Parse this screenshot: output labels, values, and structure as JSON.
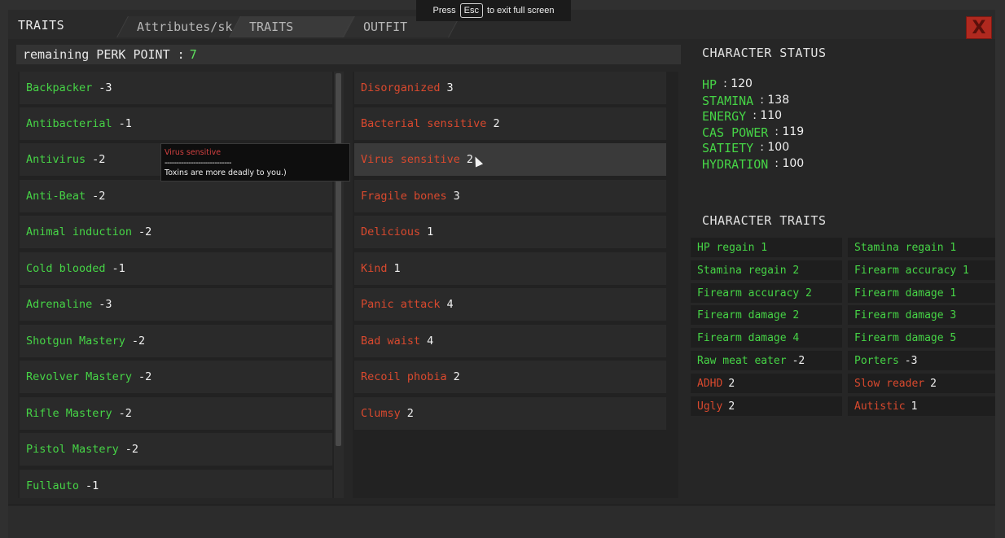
{
  "fullscreen_notice": {
    "before": "Press",
    "key": "Esc",
    "after": "to exit full screen"
  },
  "header": {
    "title": "TRAITS",
    "tabs": [
      "Attributes/sk",
      "TRAITS",
      "OUTFIT"
    ],
    "close_label": "X"
  },
  "perk": {
    "label": "remaining PERK POINT  :",
    "value": "7"
  },
  "positive_traits": [
    {
      "name": "Backpacker",
      "cost": "-3"
    },
    {
      "name": "Antibacterial",
      "cost": "-1"
    },
    {
      "name": "Antivirus",
      "cost": "-2"
    },
    {
      "name": "Anti-Beat",
      "cost": "-2"
    },
    {
      "name": "Animal induction",
      "cost": "-2"
    },
    {
      "name": "Cold blooded",
      "cost": "-1"
    },
    {
      "name": "Adrenaline",
      "cost": "-3"
    },
    {
      "name": "Shotgun Mastery",
      "cost": "-2"
    },
    {
      "name": "Revolver Mastery",
      "cost": "-2"
    },
    {
      "name": "Rifle Mastery",
      "cost": "-2"
    },
    {
      "name": "Pistol Mastery",
      "cost": "-2"
    },
    {
      "name": "Fullauto",
      "cost": "-1"
    }
  ],
  "negative_traits": [
    {
      "name": "Disorganized",
      "cost": "3"
    },
    {
      "name": "Bacterial sensitive",
      "cost": "2"
    },
    {
      "name": "Virus sensitive",
      "cost": "2"
    },
    {
      "name": "Fragile bones",
      "cost": "3"
    },
    {
      "name": "Delicious",
      "cost": "1"
    },
    {
      "name": "Kind",
      "cost": "1"
    },
    {
      "name": "Panic attack",
      "cost": "4"
    },
    {
      "name": "Bad waist",
      "cost": "4"
    },
    {
      "name": "Recoil phobia",
      "cost": "2"
    },
    {
      "name": "Clumsy",
      "cost": "2"
    }
  ],
  "tooltip": {
    "title": "Virus sensitive",
    "separator": "----------------------------",
    "description": "Toxins are more deadly to you.)"
  },
  "character_status": {
    "title": "CHARACTER STATUS",
    "stats": [
      {
        "key": "HP",
        "value": ": 120"
      },
      {
        "key": "STAMINA",
        "value": ": 138"
      },
      {
        "key": "ENERGY",
        "value": ": 110"
      },
      {
        "key": "CAS POWER",
        "value": ": 119"
      },
      {
        "key": "SATIETY",
        "value": ": 100"
      },
      {
        "key": "HYDRATION",
        "value": ": 100"
      }
    ]
  },
  "character_traits": {
    "title": "CHARACTER TRAITS",
    "rows": [
      [
        {
          "name": "HP regain 1",
          "value": "",
          "color": "green"
        },
        {
          "name": "Stamina regain 1",
          "value": "",
          "color": "green"
        }
      ],
      [
        {
          "name": "Stamina regain 2",
          "value": "",
          "color": "green"
        },
        {
          "name": "Firearm accuracy 1",
          "value": "",
          "color": "green"
        }
      ],
      [
        {
          "name": "Firearm accuracy 2",
          "value": "",
          "color": "green"
        },
        {
          "name": "Firearm damage 1",
          "value": "",
          "color": "green"
        }
      ],
      [
        {
          "name": "Firearm damage 2",
          "value": "",
          "color": "green"
        },
        {
          "name": "Firearm damage 3",
          "value": "",
          "color": "green"
        }
      ],
      [
        {
          "name": "Firearm damage 4",
          "value": "",
          "color": "green"
        },
        {
          "name": "Firearm damage 5",
          "value": "",
          "color": "green"
        }
      ],
      [
        {
          "name": "Raw meat eater",
          "value": "-2",
          "color": "green"
        },
        {
          "name": "Porters",
          "value": "-3",
          "color": "green"
        }
      ],
      [
        {
          "name": "ADHD",
          "value": "2",
          "color": "red"
        },
        {
          "name": "Slow reader",
          "value": "2",
          "color": "red"
        }
      ],
      [
        {
          "name": "Ugly",
          "value": "2",
          "color": "red"
        },
        {
          "name": "Autistic",
          "value": "1",
          "color": "red"
        }
      ]
    ]
  },
  "colors": {
    "positive": "#46d446",
    "negative": "#d9492e",
    "close": "#b0291f"
  }
}
